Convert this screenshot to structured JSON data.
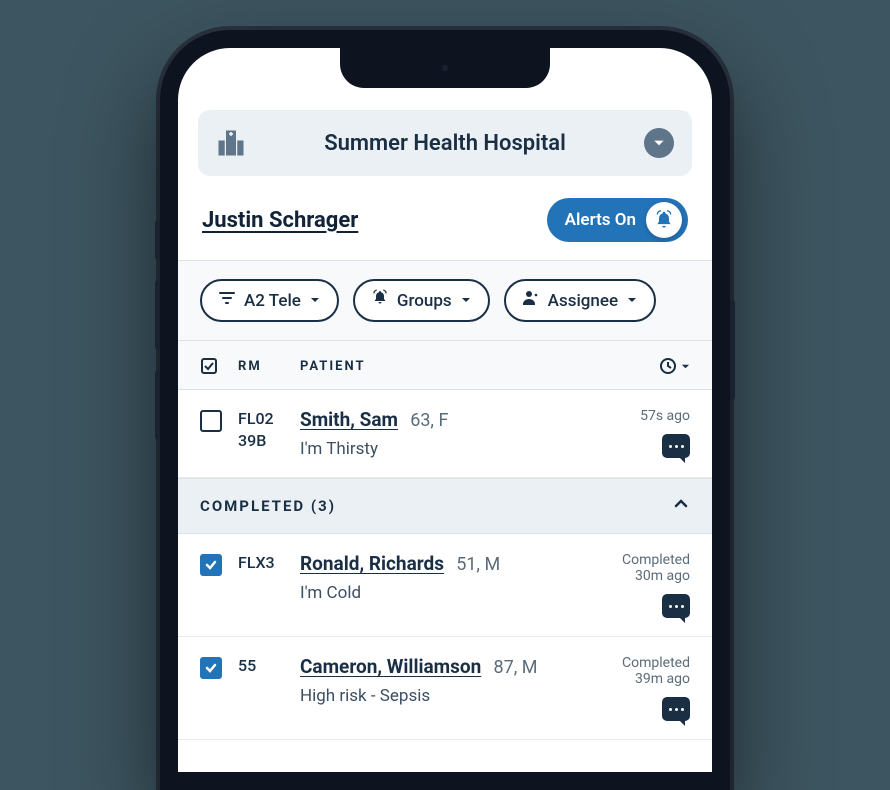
{
  "hospital": {
    "name": "Summer Health Hospital"
  },
  "user": {
    "name": "Justin Schrager"
  },
  "alerts": {
    "label": "Alerts On"
  },
  "filters": {
    "ward": "A2 Tele",
    "groups": "Groups",
    "assignee": "Assignee"
  },
  "columns": {
    "rm": "RM",
    "patient": "PATIENT"
  },
  "rows": [
    {
      "completed": false,
      "rm_line1": "FL02",
      "rm_line2": "39B",
      "name": "Smith, Sam",
      "meta": "63, F",
      "note": "I'm Thirsty",
      "time1": "57s ago",
      "time2": ""
    }
  ],
  "completed_section": {
    "label": "COMPLETED (3)"
  },
  "completed_rows": [
    {
      "rm_line1": "FLX3",
      "rm_line2": "",
      "name": "Ronald, Richards",
      "meta": "51, M",
      "note": "I'm Cold",
      "time1": "Completed",
      "time2": "30m ago"
    },
    {
      "rm_line1": "55",
      "rm_line2": "",
      "name": "Cameron, Williamson",
      "meta": "87, M",
      "note": "High risk - Sepsis",
      "time1": "Completed",
      "time2": "39m ago"
    }
  ]
}
